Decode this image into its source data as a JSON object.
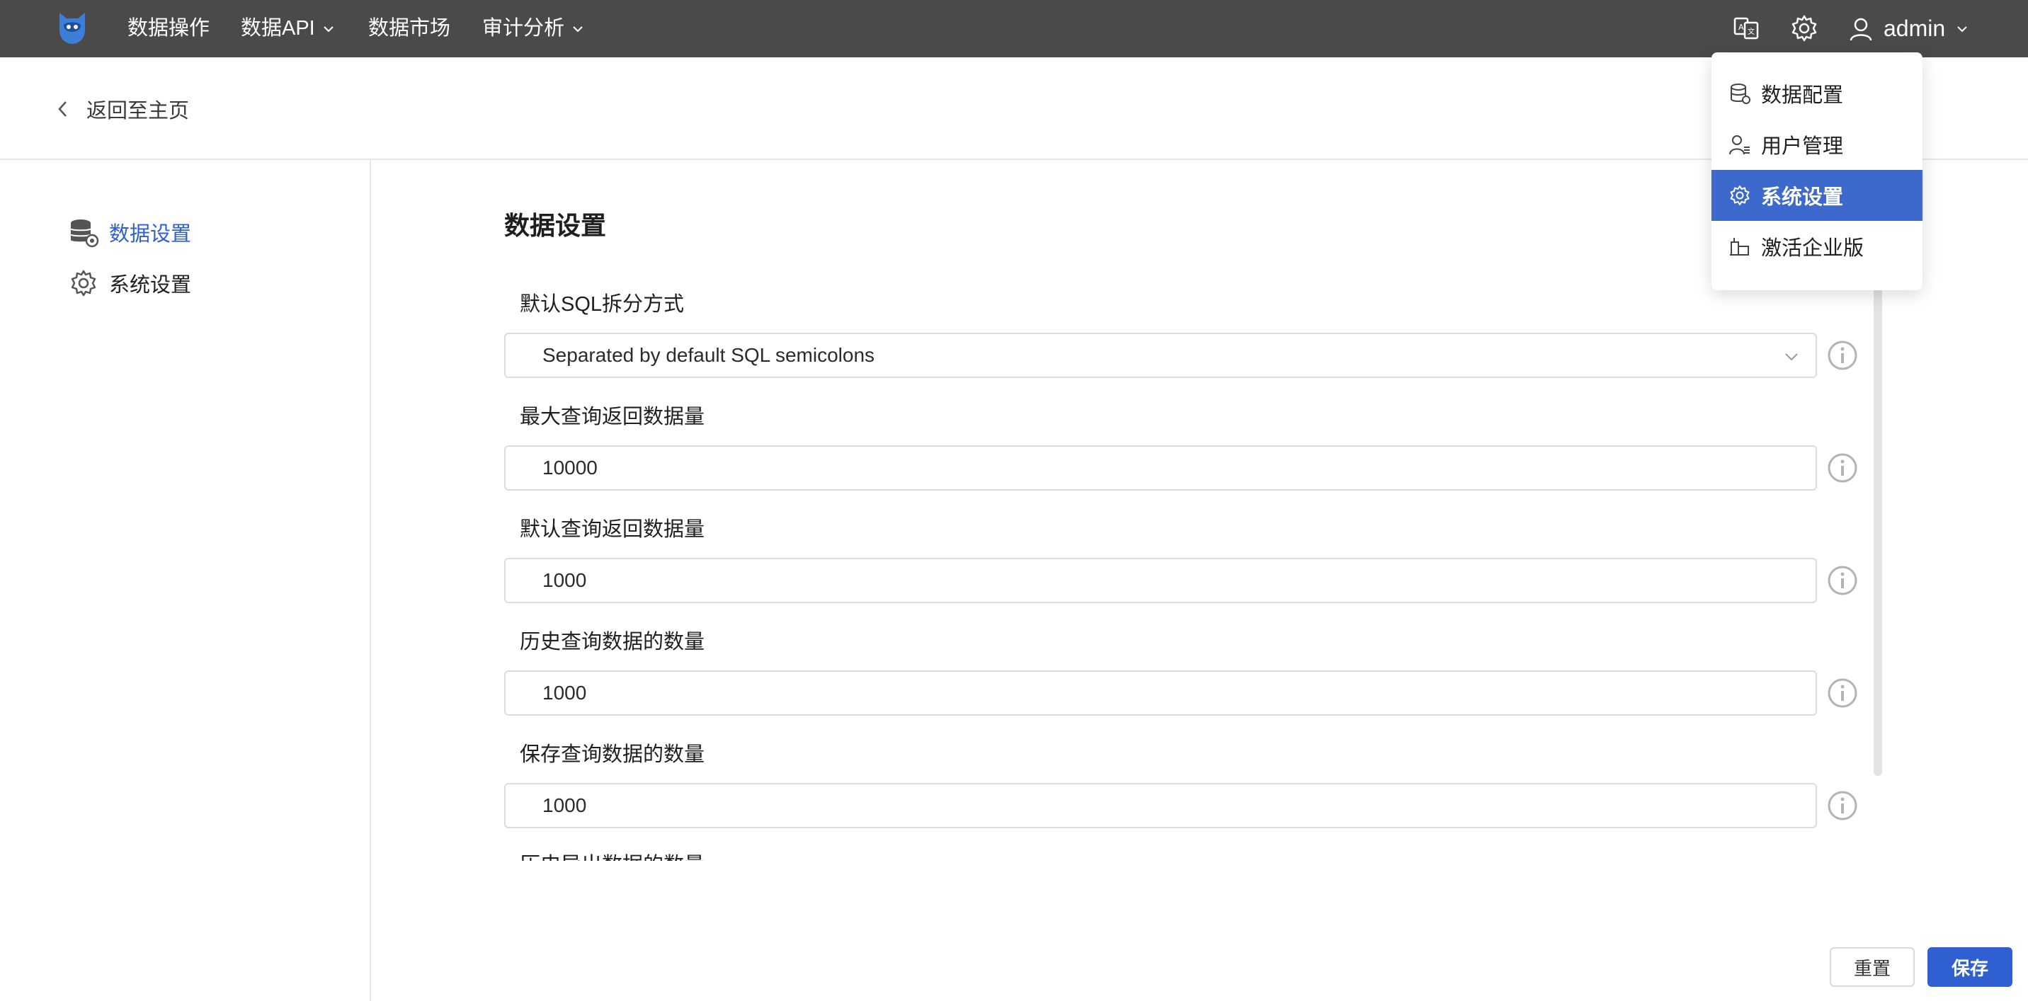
{
  "nav": {
    "items": [
      {
        "label": "数据操作",
        "has_dropdown": false
      },
      {
        "label": "数据API",
        "has_dropdown": true
      },
      {
        "label": "数据市场",
        "has_dropdown": false
      },
      {
        "label": "审计分析",
        "has_dropdown": true
      }
    ],
    "user": "admin"
  },
  "back": {
    "label": "返回至主页"
  },
  "sidebar": {
    "items": [
      {
        "label": "数据设置",
        "icon": "database-settings-icon",
        "active": true
      },
      {
        "label": "系统设置",
        "icon": "gear-icon",
        "active": false
      }
    ]
  },
  "main": {
    "title": "数据设置",
    "fields": [
      {
        "label": "默认SQL拆分方式",
        "value": "Separated by default SQL semicolons",
        "type": "select"
      },
      {
        "label": "最大查询返回数据量",
        "value": "10000",
        "type": "input"
      },
      {
        "label": "默认查询返回数据量",
        "value": "1000",
        "type": "input"
      },
      {
        "label": "历史查询数据的数量",
        "value": "1000",
        "type": "input"
      },
      {
        "label": "保存查询数据的数量",
        "value": "1000",
        "type": "input"
      }
    ],
    "cut_label": "历史导出数据的数量"
  },
  "menu": {
    "items": [
      {
        "label": "数据配置",
        "icon": "database-icon",
        "selected": false
      },
      {
        "label": "用户管理",
        "icon": "user-manage-icon",
        "selected": false
      },
      {
        "label": "系统设置",
        "icon": "gear-icon",
        "selected": true
      },
      {
        "label": "激活企业版",
        "icon": "enterprise-icon",
        "selected": false
      }
    ]
  },
  "buttons": {
    "reset": "重置",
    "save": "保存"
  },
  "colors": {
    "topbar": "#4a4a4a",
    "accent": "#2f5fd0",
    "menu_selected": "#3d68cc"
  }
}
